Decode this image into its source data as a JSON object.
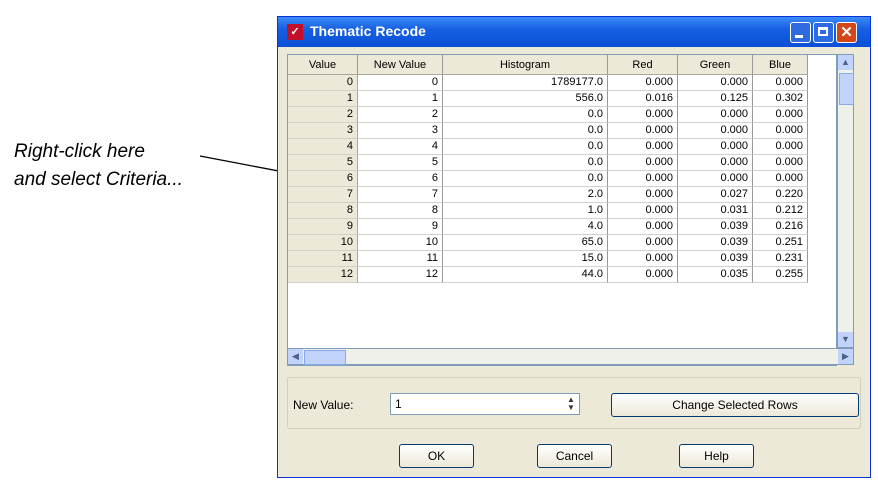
{
  "annotation": {
    "line1": "Right-click here",
    "line2": "and select Criteria..."
  },
  "window": {
    "title": "Thematic Recode",
    "title_icon": "app-icon"
  },
  "table": {
    "columns": [
      "Value",
      "New Value",
      "Histogram",
      "Red",
      "Green",
      "Blue"
    ],
    "rows": [
      [
        "0",
        "0",
        "1789177.0",
        "0.000",
        "0.000",
        "0.000"
      ],
      [
        "1",
        "1",
        "556.0",
        "0.016",
        "0.125",
        "0.302"
      ],
      [
        "2",
        "2",
        "0.0",
        "0.000",
        "0.000",
        "0.000"
      ],
      [
        "3",
        "3",
        "0.0",
        "0.000",
        "0.000",
        "0.000"
      ],
      [
        "4",
        "4",
        "0.0",
        "0.000",
        "0.000",
        "0.000"
      ],
      [
        "5",
        "5",
        "0.0",
        "0.000",
        "0.000",
        "0.000"
      ],
      [
        "6",
        "6",
        "0.0",
        "0.000",
        "0.000",
        "0.000"
      ],
      [
        "7",
        "7",
        "2.0",
        "0.000",
        "0.027",
        "0.220"
      ],
      [
        "8",
        "8",
        "1.0",
        "0.000",
        "0.031",
        "0.212"
      ],
      [
        "9",
        "9",
        "4.0",
        "0.000",
        "0.039",
        "0.216"
      ],
      [
        "10",
        "10",
        "65.0",
        "0.000",
        "0.039",
        "0.251"
      ],
      [
        "11",
        "11",
        "15.0",
        "0.000",
        "0.039",
        "0.231"
      ],
      [
        "12",
        "12",
        "44.0",
        "0.000",
        "0.035",
        "0.255"
      ]
    ]
  },
  "new_value": {
    "label": "New Value:",
    "value": "1"
  },
  "buttons": {
    "change": "Change Selected Rows",
    "ok": "OK",
    "cancel": "Cancel",
    "help": "Help"
  }
}
